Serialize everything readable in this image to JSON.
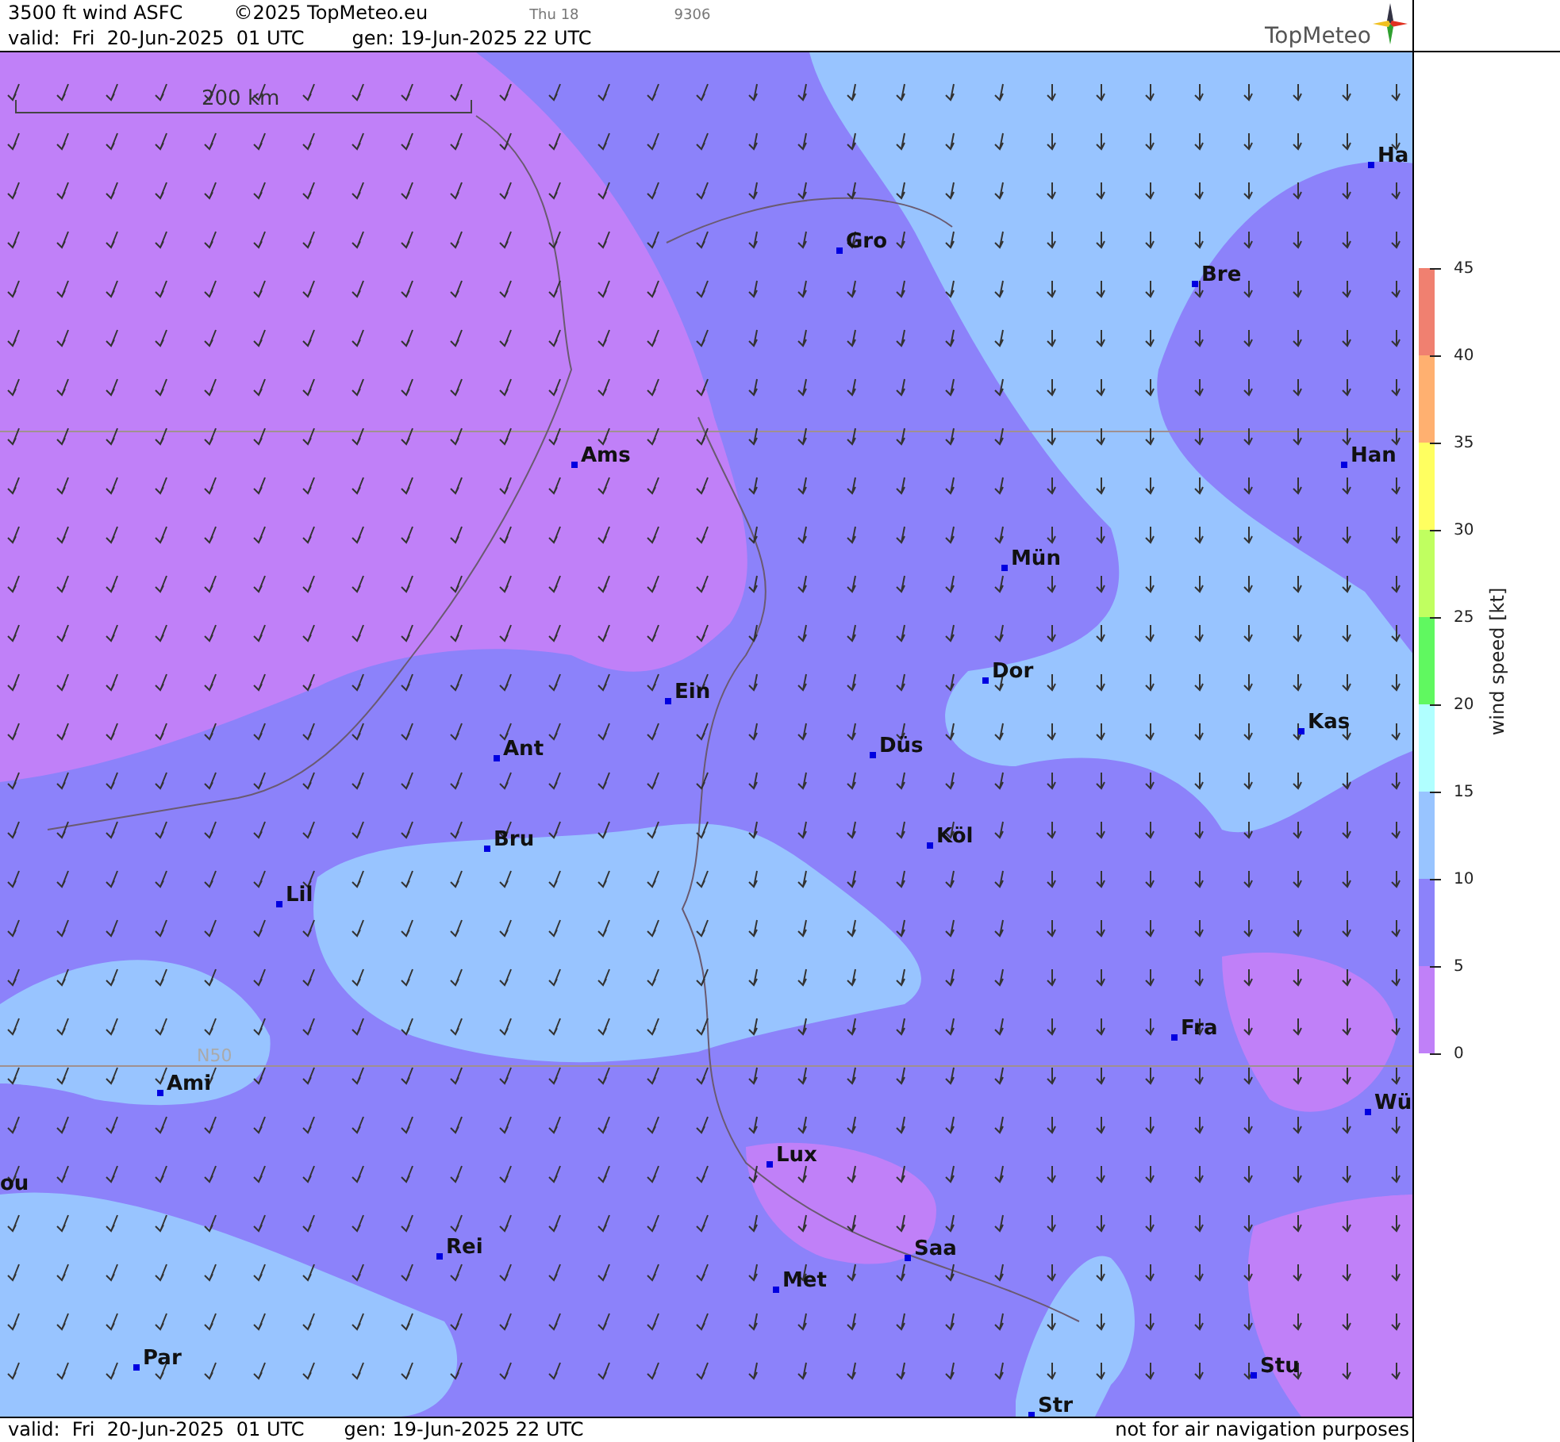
{
  "header": {
    "title": "3500 ft wind ASFC",
    "copyright": "©2025 TopMeteo.eu",
    "day": "Thu 18",
    "code": "9306",
    "valid": "valid:  Fri  20-Jun-2025  01 UTC",
    "generated": "gen: 19-Jun-2025 22 UTC",
    "logo": "TopMeteo"
  },
  "map": {
    "scale": "200 km",
    "latitude_label": "N50",
    "cities": [
      {
        "name": "Ha"
      },
      {
        "name": "Gro"
      },
      {
        "name": "Bre"
      },
      {
        "name": "Ams"
      },
      {
        "name": "Han"
      },
      {
        "name": "Mün"
      },
      {
        "name": "Dor"
      },
      {
        "name": "Ein"
      },
      {
        "name": "Kas"
      },
      {
        "name": "Düs"
      },
      {
        "name": "Ant"
      },
      {
        "name": "Köl"
      },
      {
        "name": "Bru"
      },
      {
        "name": "Lil"
      },
      {
        "name": "Fra"
      },
      {
        "name": "Ami"
      },
      {
        "name": "Wü"
      },
      {
        "name": "Lux"
      },
      {
        "name": "ou"
      },
      {
        "name": "Rei"
      },
      {
        "name": "Saa"
      },
      {
        "name": "Met"
      },
      {
        "name": "Stu"
      },
      {
        "name": "Par"
      },
      {
        "name": "Str"
      }
    ]
  },
  "legend": {
    "title": "wind speed [kt]",
    "bands": [
      {
        "color": "#f08070"
      },
      {
        "color": "#ffb070"
      },
      {
        "color": "#ffff60"
      },
      {
        "color": "#c0ff60"
      },
      {
        "color": "#60f860"
      },
      {
        "color": "#b0ffff"
      },
      {
        "color": "#98c4ff"
      },
      {
        "color": "#8c82fa"
      },
      {
        "color": "#c080f8"
      }
    ],
    "ticks": [
      "45",
      "40",
      "35",
      "30",
      "25",
      "20",
      "15",
      "10",
      "5",
      "0"
    ]
  },
  "footer": {
    "valid": "valid:  Fri  20-Jun-2025  01 UTC",
    "generated": "gen: 19-Jun-2025 22 UTC",
    "notice": "not for air navigation purposes"
  }
}
